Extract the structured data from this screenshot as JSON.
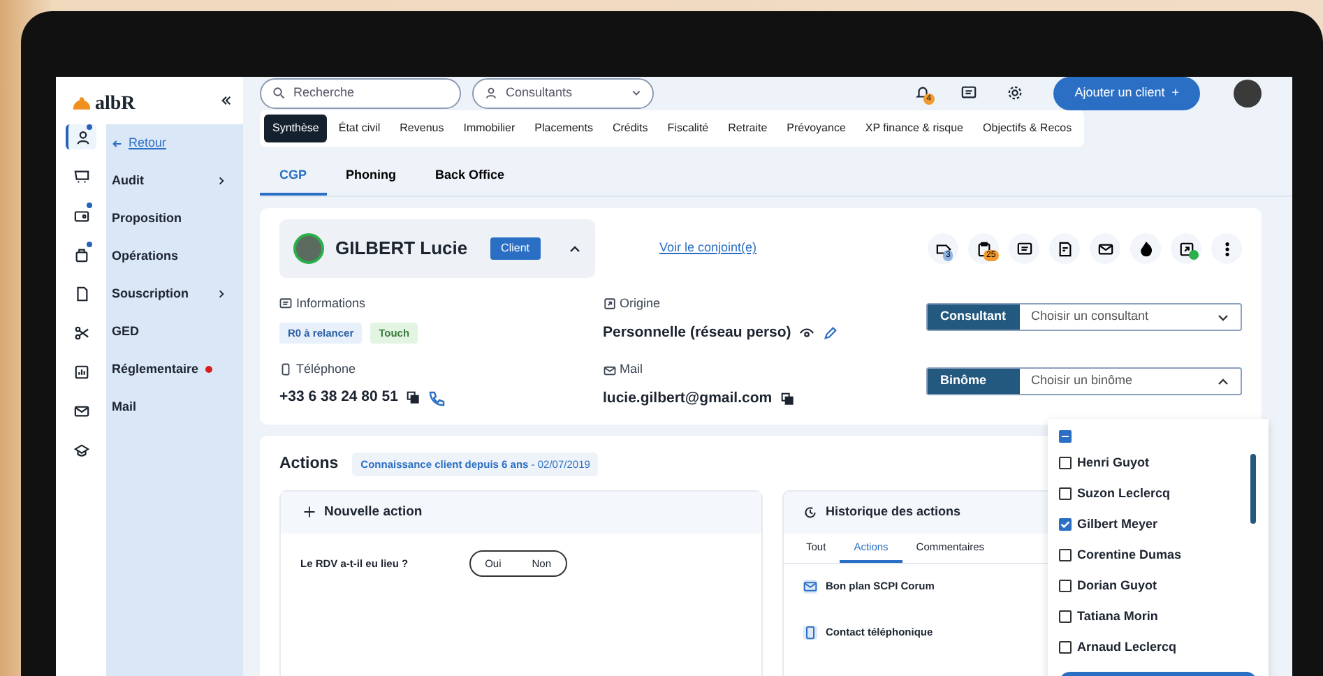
{
  "logo": "albR",
  "rail": [
    {
      "kind": "person",
      "selected": true,
      "badge": true
    },
    {
      "kind": "cart",
      "selected": false,
      "badge": false
    },
    {
      "kind": "wallet",
      "selected": false,
      "badge": true
    },
    {
      "kind": "bag",
      "selected": false,
      "badge": true
    },
    {
      "kind": "doc",
      "selected": false,
      "badge": false
    },
    {
      "kind": "scissors",
      "selected": false,
      "badge": false
    },
    {
      "kind": "chart",
      "selected": false,
      "badge": false
    },
    {
      "kind": "mail",
      "selected": false,
      "badge": false
    },
    {
      "kind": "cap",
      "selected": false,
      "badge": false
    }
  ],
  "sidebar": {
    "back": "Retour",
    "items": [
      {
        "label": "Audit",
        "submenu": true,
        "alert": false
      },
      {
        "label": "Proposition",
        "submenu": false,
        "alert": false
      },
      {
        "label": "Opérations",
        "submenu": false,
        "alert": false
      },
      {
        "label": "Souscription",
        "submenu": true,
        "alert": false
      },
      {
        "label": "GED",
        "submenu": false,
        "alert": false
      },
      {
        "label": "Réglementaire",
        "submenu": false,
        "alert": true
      },
      {
        "label": "Mail",
        "submenu": false,
        "alert": false
      }
    ]
  },
  "topbar": {
    "search": {
      "placeholder": "Recherche"
    },
    "consultants": {
      "placeholder": "Consultants"
    },
    "notifications": "4",
    "add_button": "Ajouter un client",
    "add_icon": "+"
  },
  "section_tabs": [
    {
      "label": "Synthèse",
      "selected": true
    },
    {
      "label": "État civil",
      "selected": false
    },
    {
      "label": "Revenus",
      "selected": false
    },
    {
      "label": "Immobilier",
      "selected": false
    },
    {
      "label": "Placements",
      "selected": false
    },
    {
      "label": "Crédits",
      "selected": false
    },
    {
      "label": "Fiscalité",
      "selected": false
    },
    {
      "label": "Retraite",
      "selected": false
    },
    {
      "label": "Prévoyance",
      "selected": false
    },
    {
      "label": "XP finance & risque",
      "selected": false
    },
    {
      "label": "Objectifs & Recos",
      "selected": false
    }
  ],
  "sub_tabs": [
    {
      "label": "CGP",
      "selected": true
    },
    {
      "label": "Phoning",
      "selected": false
    },
    {
      "label": "Back Office",
      "selected": false
    }
  ],
  "client": {
    "name": "GILBERT Lucie",
    "status": "Client",
    "expanded": true,
    "spouse_link": "Voir le conjoint(e)",
    "actions": [
      {
        "kind": "tag",
        "count": "3",
        "online": false
      },
      {
        "kind": "clipboard",
        "count": "25",
        "online": false
      },
      {
        "kind": "chat",
        "online": false
      },
      {
        "kind": "file",
        "online": false
      },
      {
        "kind": "mail",
        "online": false
      },
      {
        "kind": "fire",
        "online": false
      },
      {
        "kind": "export",
        "online": true
      },
      {
        "kind": "more",
        "online": false
      }
    ],
    "informations": {
      "label": "Informations",
      "tags": [
        {
          "label": "R0 à relancer",
          "color": "#e8f0fb"
        },
        {
          "label": "Touch",
          "color": "#e3f4e3"
        }
      ]
    },
    "origine": {
      "label": "Origine",
      "value": "Personnelle (réseau perso)"
    },
    "telephone": {
      "label": "Téléphone",
      "value": "+33 6 38 24 80 51"
    },
    "mail": {
      "label": "Mail",
      "value": "lucie.gilbert@gmail.com"
    },
    "consultant": {
      "label": "Consultant",
      "placeholder": "Choisir un consultant",
      "expanded": false
    },
    "binome": {
      "label": "Binôme",
      "placeholder": "Choisir un binôme",
      "expanded": true,
      "select_all_indeterminate": true,
      "options": [
        {
          "label": "Henri Guyot",
          "checked": false
        },
        {
          "label": "Suzon Leclercq",
          "checked": false
        },
        {
          "label": "Gilbert Meyer",
          "checked": true
        },
        {
          "label": "Corentine Dumas",
          "checked": false
        },
        {
          "label": "Dorian Guyot",
          "checked": false
        },
        {
          "label": "Tatiana Morin",
          "checked": false
        },
        {
          "label": "Arnaud Leclercq",
          "checked": false
        }
      ]
    }
  },
  "actions": {
    "title": "Actions",
    "since": "Connaissance client depuis 6 ans",
    "date": " - 02/07/2019",
    "new_action": {
      "title": "Nouvelle action",
      "question": "Le RDV a-t-il eu lieu ?",
      "options": [
        {
          "label": "Oui",
          "selected": false
        },
        {
          "label": "Non",
          "selected": false
        }
      ]
    },
    "history": {
      "title": "Historique des actions",
      "tabs": [
        {
          "label": "Tout",
          "selected": false
        },
        {
          "label": "Actions",
          "selected": true
        },
        {
          "label": "Commentaires",
          "selected": false
        }
      ],
      "entries": [
        {
          "kind": "mail",
          "label": "Bon plan SCPI Corum"
        },
        {
          "kind": "phone",
          "label": "Contact téléphonique"
        }
      ]
    }
  }
}
